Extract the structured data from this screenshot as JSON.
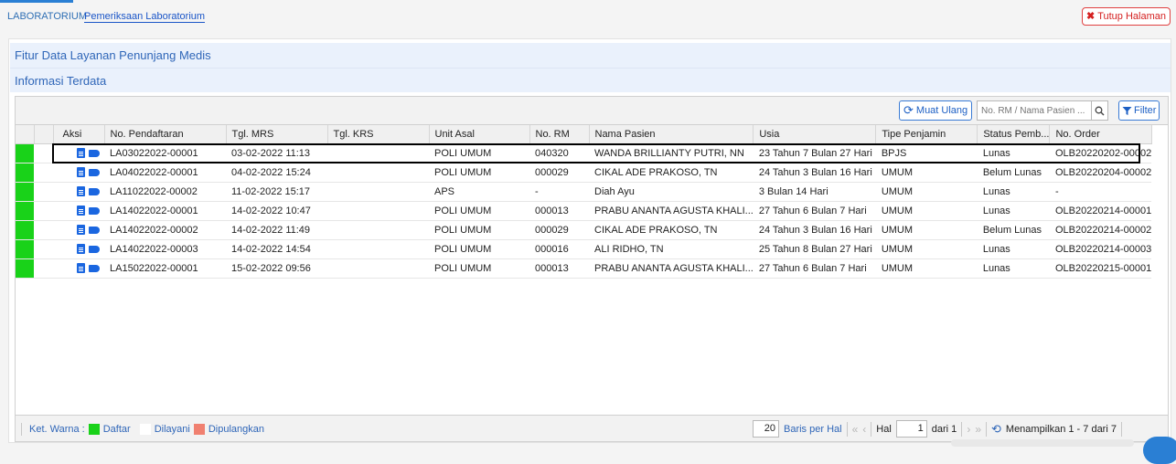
{
  "breadcrumb": {
    "root": "LABORATORIUM",
    "current": "Pemeriksaan Laboratorium"
  },
  "close_button": "Tutup Halaman",
  "section_title": "Fitur Data Layanan Penunjang Medis",
  "subsection_title": "Informasi Terdata",
  "toolbar": {
    "reload_label": "Muat Ulang",
    "search_placeholder": "No. RM / Nama Pasien ...",
    "filter_label": "Filter"
  },
  "table": {
    "columns": [
      "Aksi",
      "No. Pendaftaran",
      "Tgl. MRS",
      "Tgl. KRS",
      "Unit Asal",
      "No. RM",
      "Nama Pasien",
      "Usia",
      "Tipe Penjamin",
      "Status Pemb...",
      "No. Order"
    ],
    "rows": [
      [
        "LA03022022-00001",
        "03-02-2022 11:13",
        "",
        "POLI UMUM",
        "040320",
        "WANDA BRILLIANTY PUTRI, NN",
        "23 Tahun 7 Bulan 27 Hari",
        "BPJS",
        "Lunas",
        "OLB20220202-00002"
      ],
      [
        "LA04022022-00001",
        "04-02-2022 15:24",
        "",
        "POLI UMUM",
        "000029",
        "CIKAL ADE PRAKOSO, TN",
        "24 Tahun 3 Bulan 16 Hari",
        "UMUM",
        "Belum Lunas",
        "OLB20220204-00002"
      ],
      [
        "LA11022022-00002",
        "11-02-2022 15:17",
        "",
        "APS",
        "-",
        "Diah Ayu",
        "3 Bulan 14 Hari",
        "UMUM",
        "Lunas",
        "-"
      ],
      [
        "LA14022022-00001",
        "14-02-2022 10:47",
        "",
        "POLI UMUM",
        "000013",
        "PRABU ANANTA AGUSTA KHALI...",
        "27 Tahun 6 Bulan 7 Hari",
        "UMUM",
        "Lunas",
        "OLB20220214-00001"
      ],
      [
        "LA14022022-00002",
        "14-02-2022 11:49",
        "",
        "POLI UMUM",
        "000029",
        "CIKAL ADE PRAKOSO, TN",
        "24 Tahun 3 Bulan 16 Hari",
        "UMUM",
        "Belum Lunas",
        "OLB20220214-00002"
      ],
      [
        "LA14022022-00003",
        "14-02-2022 14:54",
        "",
        "POLI UMUM",
        "000016",
        "ALI RIDHO, TN",
        "25 Tahun 8 Bulan 27 Hari",
        "UMUM",
        "Lunas",
        "OLB20220214-00003"
      ],
      [
        "LA15022022-00001",
        "15-02-2022 09:56",
        "",
        "POLI UMUM",
        "000013",
        "PRABU ANANTA AGUSTA KHALI...",
        "27 Tahun 6 Bulan 7 Hari",
        "UMUM",
        "Lunas",
        "OLB20220215-00001"
      ]
    ]
  },
  "legend": {
    "title": "Ket. Warna :",
    "items": [
      {
        "label": "Daftar",
        "color": "#19d219"
      },
      {
        "label": "Dilayani",
        "color": "#ffffff"
      },
      {
        "label": "Dipulangkan",
        "color": "#f08070"
      }
    ]
  },
  "pager": {
    "per_page": "20",
    "per_page_label": "Baris per Hal",
    "page_label": "Hal",
    "page": "1",
    "of_label": "dari 1",
    "summary": "Menampilkan 1 - 7 dari 7"
  },
  "colors": {
    "accent": "#2a7fd4",
    "row_marker": "#19d219",
    "danger": "#d42020"
  }
}
